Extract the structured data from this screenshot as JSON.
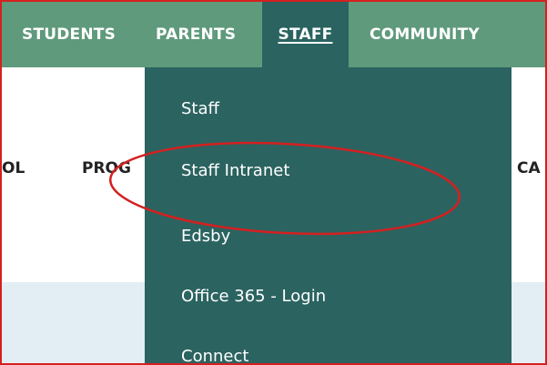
{
  "topnav": {
    "items": [
      {
        "label": "STUDENTS"
      },
      {
        "label": "PARENTS"
      },
      {
        "label": "STAFF"
      },
      {
        "label": "COMMUNITY"
      }
    ]
  },
  "secondary_nav": {
    "items": [
      {
        "label": "OL"
      },
      {
        "label": "PROG"
      },
      {
        "label": "CA"
      }
    ]
  },
  "staff_menu": {
    "items": [
      {
        "label": "Staff"
      },
      {
        "label": "Staff Intranet"
      },
      {
        "label": "Edsby"
      },
      {
        "label": "Office 365 - Login"
      },
      {
        "label": "Connect"
      }
    ]
  },
  "colors": {
    "nav_bar": "#5e9a7b",
    "active_menu": "#2b6360",
    "annotation": "#d42020",
    "content_band": "#e3edf4"
  }
}
